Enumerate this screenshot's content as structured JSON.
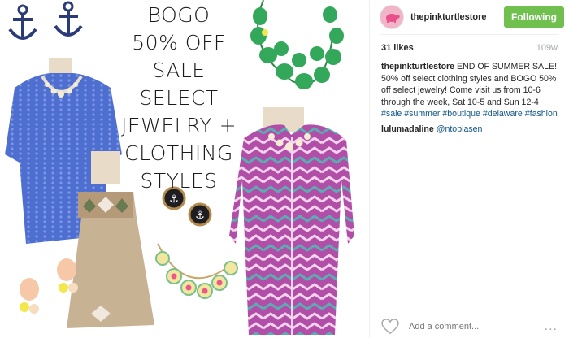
{
  "photo": {
    "promo_lines": [
      "BOGO",
      "50% OFF",
      "SALE SELECT",
      "JEWELRY +",
      "CLOTHING",
      "STYLES"
    ]
  },
  "post": {
    "username": "thepinkturtlestore",
    "follow_label": "Following",
    "likes": "31 likes",
    "time_ago": "109w",
    "caption": {
      "username": "thepinkturtlestore",
      "text": " END OF SUMMER SALE! 50% off select clothing styles and BOGO 50% off select jewelry! Come visit us from 10-6 through the week, Sat 10-5 and Sun 12-4 ",
      "hashtags": [
        "#sale",
        "#summer",
        "#boutique",
        "#delaware",
        "#fashion"
      ]
    },
    "comments": [
      {
        "username": "lulumadaline",
        "mention": "@ntobiasen"
      }
    ],
    "add_comment_placeholder": "Add a comment...",
    "more_label": "..."
  },
  "colors": {
    "follow_green": "#70c050",
    "link_blue": "#125688",
    "muted_gray": "#a5a7aa"
  },
  "icons": {
    "like": "heart-outline-icon",
    "more": "ellipsis-icon"
  }
}
